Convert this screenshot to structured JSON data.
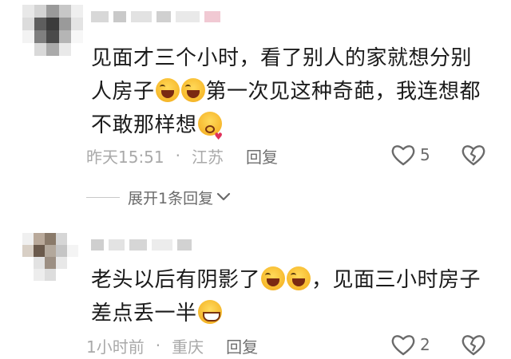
{
  "comments": [
    {
      "text_parts": [
        "见面才三个小时，看了别人的家就想分别人房子",
        "第一次见这种奇葩，我连想都不敢那样想"
      ],
      "line1": "见面才三个小时，看了别人的家就想分别",
      "line2a": "人房子",
      "line2b": "第一次见这种奇葩，我连想都",
      "line3": "不敢那样想",
      "emojis": [
        "face-with-tears-icon",
        "face-with-tears-icon",
        "kissing-face-icon"
      ],
      "time": "昨天15:51",
      "location": "江苏",
      "reply_label": "回复",
      "likes": "5",
      "expand_label": "展开1条回复"
    },
    {
      "line1": "老头以后有阴影了",
      "line1b": "，见面三小时房子",
      "line2": "差点丢一半",
      "emojis": [
        "face-with-tears-icon",
        "face-with-tears-icon",
        "grinning-sweat-icon"
      ],
      "time": "1小时前",
      "location": "重庆",
      "reply_label": "回复",
      "likes": "2"
    }
  ],
  "separator": "·",
  "colors": {
    "text": "#1b1b1b",
    "meta": "#a9a9a9",
    "action": "#6a6a6a"
  }
}
